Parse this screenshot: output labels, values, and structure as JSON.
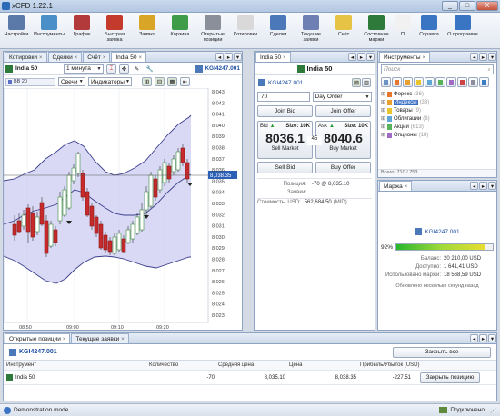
{
  "window": {
    "title": "xCFD 1.22.1",
    "min": "_",
    "max": "□",
    "close": "X"
  },
  "toolbar": [
    {
      "label": "Настройки",
      "color": "#5a78a8"
    },
    {
      "label": "Инструменты",
      "color": "#4a8fc7"
    },
    {
      "label": "График",
      "color": "#b33a3a"
    },
    {
      "label": "Быстрая заявка",
      "color": "#c43b2e"
    },
    {
      "label": "Заявка",
      "color": "#d9a526"
    },
    {
      "label": "Корзина",
      "color": "#3e9b48"
    },
    {
      "label": "Открытые позиции",
      "color": "#8a8f9a"
    },
    {
      "label": "Котировки",
      "color": "#d9d9d9"
    },
    {
      "label": "Сделки",
      "color": "#4a78b8"
    },
    {
      "label": "Текущие заявки",
      "color": "#6d7fb3"
    },
    {
      "label": "Счёт",
      "color": "#e6c344"
    },
    {
      "label": "Состояние маржи",
      "color": "#2e7a3b"
    },
    {
      "label": "П",
      "color": "#f1f1f1"
    },
    {
      "label": "Справка",
      "color": "#3a75c4"
    },
    {
      "label": "О программе",
      "color": "#3a75c4"
    }
  ],
  "chart_panel": {
    "tabs": [
      "Котировки",
      "Сделки",
      "Счёт",
      "India 50"
    ],
    "instrument": "India 50",
    "interval": "1 минута",
    "account": "KGI4247.001",
    "bb_label": "BB 20",
    "candles_btn": "Свечи",
    "indicators_btn": "Индикаторы",
    "current_price": "8,038.35",
    "y_ticks": [
      "8,043",
      "8,042",
      "8,041",
      "8,040",
      "8,039",
      "8,038",
      "8,037",
      "8,036",
      "8,035",
      "8,034",
      "8,033",
      "8,032",
      "8,031",
      "8,030",
      "8,029",
      "8,028",
      "8,027",
      "8,026",
      "8,025",
      "8,024",
      "8,023"
    ],
    "x_ticks": [
      "08:50",
      "09:00",
      "09:10",
      "09:20"
    ]
  },
  "order_panel": {
    "tab": "India 50",
    "instrument": "India 50",
    "account": "KGI4247.001",
    "quantity": "70",
    "order_type": "Day Order",
    "join_bid": "Join Bid",
    "join_offer": "Join Offer",
    "bid_label": "Bid",
    "bid_size": "Size: 10K",
    "ask_label": "Ask",
    "ask_size": "Size: 10K",
    "bid_price": "8036.1",
    "spread": "45",
    "ask_price": "8040.6",
    "sell_market": "Sell Market",
    "buy_market": "Buy Market",
    "sell_bid": "Sell Bid",
    "buy_offer": "Buy Offer",
    "position_label": "Позиция:",
    "position_value": "-70 @ 8,035.10",
    "orders_label": "Заявки:",
    "orders_value": "...",
    "value_label": "Стоимость, USD:",
    "value_value": "562,684.50",
    "value_suffix": "(MID)"
  },
  "instruments_panel": {
    "tab": "Инструменты",
    "search_placeholder": "Поиск",
    "tree": [
      {
        "name": "Форекс",
        "count": "(36)",
        "color": "#e8772e"
      },
      {
        "name": "Индексы",
        "count": "(38)",
        "color": "#e8a12e"
      },
      {
        "name": "Товары",
        "count": "(9)",
        "color": "#e8c52e"
      },
      {
        "name": "Облигации",
        "count": "(6)",
        "color": "#5fa7d6"
      },
      {
        "name": "Акции",
        "count": "(613)",
        "color": "#58b35b"
      },
      {
        "name": "Опционы",
        "count": "(18)",
        "color": "#a06bc4"
      }
    ],
    "footer": "Всего: 710 / 753"
  },
  "margin_panel": {
    "tab": "Маржа",
    "account": "KGI4247.001",
    "percent": "92%",
    "level": 0.92,
    "balance_label": "Баланс:",
    "balance_value": "20 210,00 USD",
    "available_label": "Доступно:",
    "available_value": "1 641,41 USD",
    "used_label": "Использовано маржи:",
    "used_value": "18 568,59 USD",
    "updated": "Обновлено несколько секунд назад"
  },
  "positions_panel": {
    "tabs": [
      "Открытые позиции",
      "Текущие заявки"
    ],
    "account": "KGI4247.001",
    "close_all": "Закрыть все",
    "headers": [
      "Инструмент",
      "Количество",
      "Средняя цена",
      "Цена",
      "Прибыль/Убыток (USD)"
    ],
    "rows": [
      {
        "instrument": "India 50",
        "quantity": "-70",
        "avg_price": "8,035.10",
        "price": "8,038.35",
        "pnl": "-227.51",
        "action": "Закрыть позицию"
      }
    ]
  },
  "status": {
    "mode": "Demonstration mode.",
    "connection": "Подключено"
  }
}
